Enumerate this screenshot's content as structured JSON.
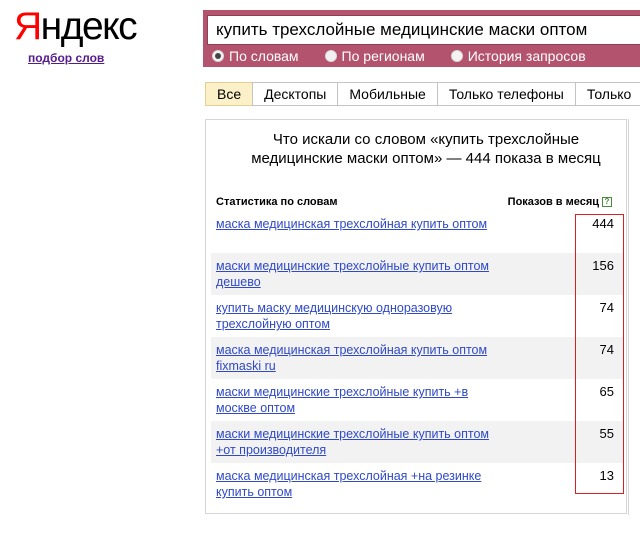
{
  "logo": {
    "first": "Я",
    "rest": "ндекс"
  },
  "header": {
    "podbor_link": "подбор слов"
  },
  "search": {
    "query": "купить трехслойные медицинские маски оптом",
    "radios": [
      {
        "label": "По словам",
        "checked": true
      },
      {
        "label": "По регионам",
        "checked": false
      },
      {
        "label": "История запросов",
        "checked": false
      }
    ]
  },
  "tabs": [
    {
      "label": "Все",
      "active": true
    },
    {
      "label": "Десктопы",
      "active": false
    },
    {
      "label": "Мобильные",
      "active": false
    },
    {
      "label": "Только телефоны",
      "active": false
    },
    {
      "label": "Только",
      "active": false
    }
  ],
  "stats": {
    "title": "Что искали со словом «купить трехслойные медицинские маски оптом» — 444 показа в месяц",
    "col_keywords": "Статистика по словам",
    "col_shows": "Показов в месяц",
    "help_glyph": "?",
    "rows": [
      {
        "keyword": "маска медицинская трехслойная купить оптом",
        "count": "444"
      },
      {
        "keyword": "маски медицинские трехслойные купить оптом дешево",
        "count": "156"
      },
      {
        "keyword": "купить маску медицинскую одноразовую трехслойную оптом",
        "count": "74"
      },
      {
        "keyword": "маска медицинская трехслойная купить оптом fixmaski ru",
        "count": "74"
      },
      {
        "keyword": "маски медицинские трехслойные купить +в москве оптом",
        "count": "65"
      },
      {
        "keyword": "маски медицинские трехслойные купить оптом +от производителя",
        "count": "55"
      },
      {
        "keyword": "маска медицинская трехслойная +на резинке купить оптом",
        "count": "13"
      }
    ]
  },
  "colors": {
    "accent": "#b3536d",
    "link": "#2f49c7",
    "highlight": "#d82020",
    "active_tab": "#fcf0c8"
  }
}
